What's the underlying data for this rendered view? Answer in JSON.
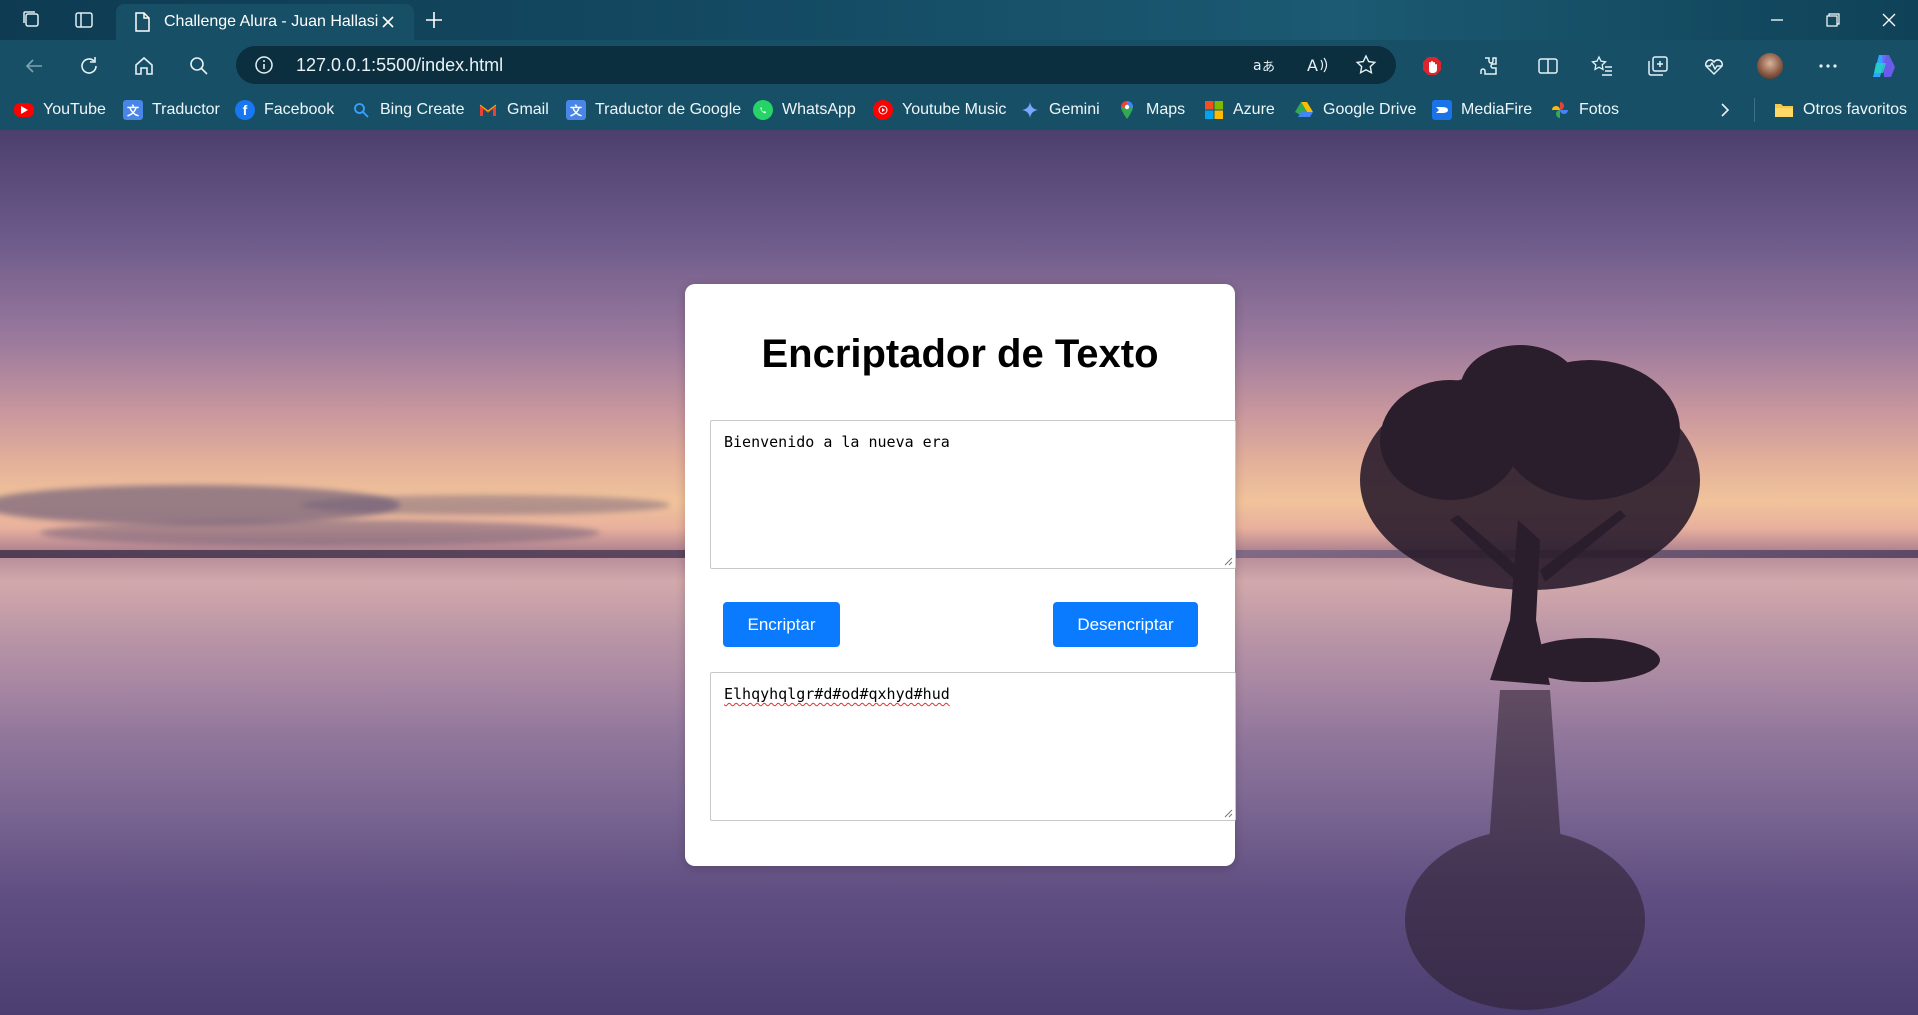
{
  "browser": {
    "tab_title": "Challenge Alura - Juan Hallasi",
    "url": "127.0.0.1:5500/index.html",
    "bookmarks": [
      {
        "label": "YouTube",
        "icon": "youtube-icon",
        "color": "#ff0000"
      },
      {
        "label": "Traductor",
        "icon": "translate-icon",
        "color": "#4a86e8"
      },
      {
        "label": "Facebook",
        "icon": "facebook-icon",
        "color": "#1877f2"
      },
      {
        "label": "Bing Create",
        "icon": "search-icon",
        "color": "#2b88d8"
      },
      {
        "label": "Gmail",
        "icon": "gmail-icon",
        "color": "#ea4335"
      },
      {
        "label": "Traductor de Google",
        "icon": "translate-icon",
        "color": "#4a86e8"
      },
      {
        "label": "WhatsApp",
        "icon": "whatsapp-icon",
        "color": "#25d366"
      },
      {
        "label": "Youtube Music",
        "icon": "youtube-music-icon",
        "color": "#ff0000"
      },
      {
        "label": "Gemini",
        "icon": "gemini-icon",
        "color": "#6ea8fe"
      },
      {
        "label": "Maps",
        "icon": "maps-icon",
        "color": "#34a853"
      },
      {
        "label": "Azure",
        "icon": "microsoft-icon",
        "color": "#f25022"
      },
      {
        "label": "Google Drive",
        "icon": "google-drive-icon",
        "color": "#fbbc04"
      },
      {
        "label": "MediaFire",
        "icon": "mediafire-icon",
        "color": "#1a73e8"
      },
      {
        "label": "Fotos",
        "icon": "photos-icon",
        "color": "#ea4335"
      }
    ],
    "other_favorites": "Otros favoritos"
  },
  "app": {
    "title": "Encriptador de Texto",
    "input_text": "Bienvenido a la nueva era",
    "output_text": "Elhqyhqlgr#d#od#qxhyd#hud",
    "encrypt_label": "Encriptar",
    "decrypt_label": "Desencriptar",
    "accent_color": "#0a7bff"
  }
}
